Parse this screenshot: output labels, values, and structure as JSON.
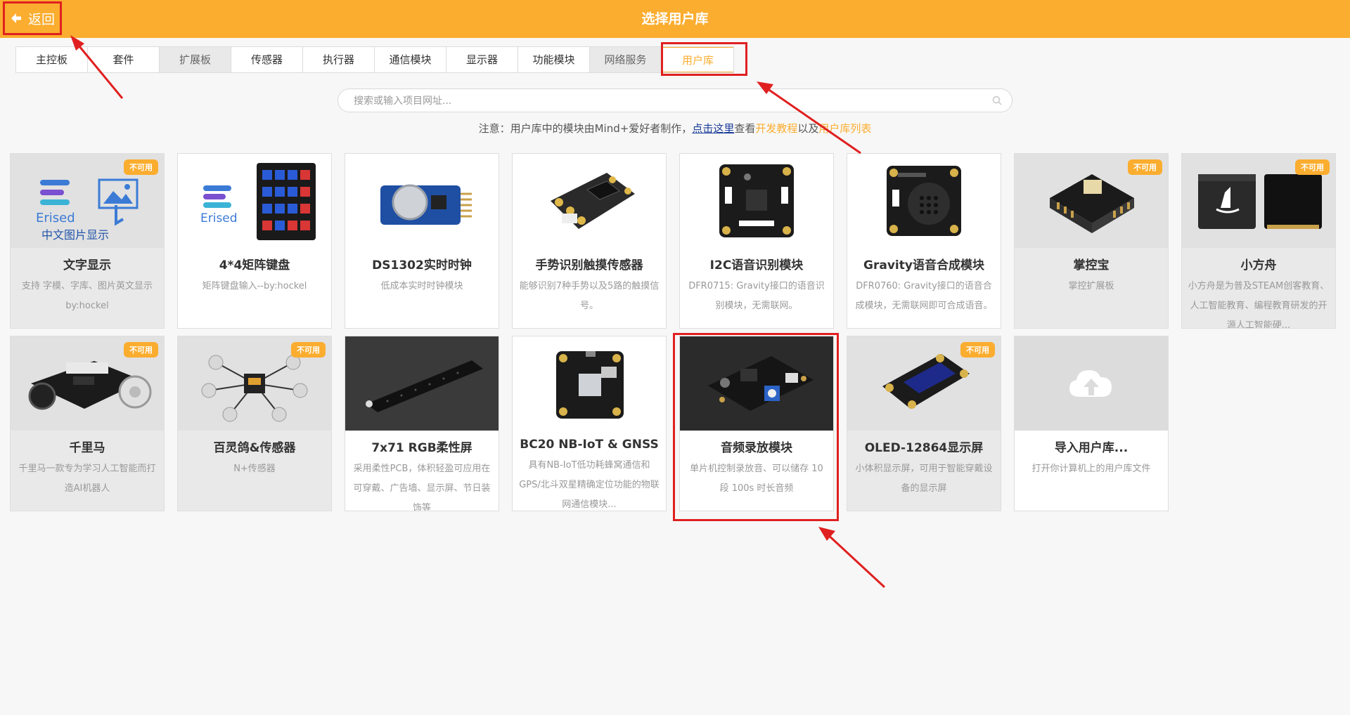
{
  "header": {
    "back_label": "返回",
    "title": "选择用户库",
    "back_icon": "arrow-left-icon"
  },
  "tabs": [
    {
      "label": "主控板",
      "state": "normal"
    },
    {
      "label": "套件",
      "state": "normal"
    },
    {
      "label": "扩展板",
      "state": "gray"
    },
    {
      "label": "传感器",
      "state": "normal"
    },
    {
      "label": "执行器",
      "state": "normal"
    },
    {
      "label": "通信模块",
      "state": "normal"
    },
    {
      "label": "显示器",
      "state": "normal"
    },
    {
      "label": "功能模块",
      "state": "normal"
    },
    {
      "label": "网络服务",
      "state": "gray"
    },
    {
      "label": "用户库",
      "state": "active"
    }
  ],
  "search": {
    "placeholder": "搜索或输入项目网址...",
    "value": "",
    "icon": "search-icon"
  },
  "notice": {
    "prefix": "注意：用户库中的模块由Mind+爱好者制作，",
    "link_here": "点击这里",
    "middle": "查看",
    "link_tutorial": "开发教程",
    "connector": "以及",
    "link_list": "用户库列表"
  },
  "badge_label": "不可用",
  "cards": [
    {
      "name": "文字显示",
      "desc": "支持 字模、字库、图片英文显示 by:hockel",
      "disabled": true,
      "icon": "erised-text-display-icon"
    },
    {
      "name": "4*4矩阵键盘",
      "desc": "矩阵键盘输入--by:hockel",
      "disabled": false,
      "icon": "keypad-icon"
    },
    {
      "name": "DS1302实时时钟",
      "desc": "低成本实时时钟模块",
      "disabled": false,
      "icon": "rtc-module-icon"
    },
    {
      "name": "手势识别触摸传感器",
      "desc": "能够识别7种手势以及5路的触摸信号。",
      "disabled": false,
      "icon": "gesture-sensor-icon"
    },
    {
      "name": "I2C语音识别模块",
      "desc": "DFR0715: Gravity接口的语音识别模块，无需联网。",
      "disabled": false,
      "icon": "voice-recognition-icon"
    },
    {
      "name": "Gravity语音合成模块",
      "desc": "DFR0760: Gravity接口的语音合成模块，无需联网即可合成语音。",
      "disabled": false,
      "icon": "speech-synthesis-icon"
    },
    {
      "name": "掌控宝",
      "desc": "掌控扩展板",
      "disabled": true,
      "icon": "expansion-board-icon"
    },
    {
      "name": "小方舟",
      "desc": "小方舟是为普及STEAM创客教育、人工智能教育、编程教育研发的开源人工智能硬...",
      "disabled": true,
      "icon": "ark-device-icon"
    },
    {
      "name": "千里马",
      "desc": "千里马一款专为学习人工智能而打造AI机器人",
      "disabled": true,
      "icon": "robot-car-icon"
    },
    {
      "name": "百灵鸽&传感器",
      "desc": "N+传感器",
      "disabled": true,
      "icon": "sensor-kit-icon"
    },
    {
      "name": "7x71 RGB柔性屏",
      "desc": "采用柔性PCB，体积轻盈可应用在可穿戴、广告墙、显示屏、节日装饰等",
      "disabled": false,
      "icon": "flexible-led-strip-icon"
    },
    {
      "name": "BC20 NB-IoT & GNSS",
      "desc": "具有NB-IoT低功耗蜂窝通信和GPS/北斗双星精确定位功能的物联网通信模块...",
      "disabled": false,
      "icon": "nbiot-module-icon"
    },
    {
      "name": "音频录放模块",
      "desc": "单片机控制录放音、可以储存 10 段 100s 时长音频",
      "disabled": false,
      "icon": "audio-recorder-icon"
    },
    {
      "name": "OLED-12864显示屏",
      "desc": "小体积显示屏，可用于智能穿戴设备的显示屏",
      "disabled": true,
      "icon": "oled-display-icon"
    },
    {
      "name": "导入用户库...",
      "desc": "打开你计算机上的用户库文件",
      "disabled": false,
      "icon": "cloud-upload-icon"
    }
  ],
  "colors": {
    "accent": "#fbad2f",
    "annotation_red": "#e02020",
    "link_blue": "#1a3c9a"
  }
}
